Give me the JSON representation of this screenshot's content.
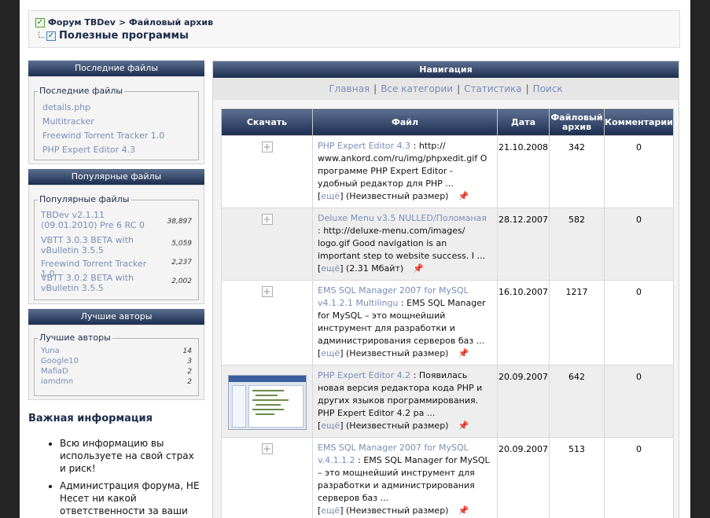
{
  "breadcrumb": {
    "forum": "Форум TBDev",
    "separator": ">",
    "section": "Файловый архив",
    "title": "Полезные программы"
  },
  "recent": {
    "header": "Последние файлы",
    "legend": "Последние файлы",
    "items": [
      "details.php",
      "Multitracker",
      "Freewind Torrent Tracker 1.0",
      "PHP Expert Editor 4.3"
    ]
  },
  "popular": {
    "header": "Популярные файлы",
    "legend": "Популярные файлы",
    "items": [
      {
        "name": "TBDev v2.1.11 (09.01.2010) Pre 6 RC 0",
        "count": "38,897"
      },
      {
        "name": "VBTT 3.0.3 BETA with vBulletin 3.5.5",
        "count": "5,059"
      },
      {
        "name": "Freewind Torrent Tracker 1.0",
        "count": "2,237"
      },
      {
        "name": "VBTT 3.0.2 BETA with vBulletin 3.5.5",
        "count": "2,002"
      }
    ]
  },
  "authors": {
    "header": "Лучшие авторы",
    "legend": "Лучшие авторы",
    "items": [
      {
        "name": "Yuna",
        "count": "14"
      },
      {
        "name": "Google10",
        "count": "3"
      },
      {
        "name": "MafiaD",
        "count": "2"
      },
      {
        "name": "iamdmn",
        "count": "2"
      }
    ]
  },
  "info": {
    "title": "Важная информация",
    "items": [
      "Всю информацию вы используете на свой страх и риск!",
      "Администрация форума, НЕ Несет ни какой ответственности за ваши файлы"
    ]
  },
  "nav": {
    "header": "Навигация",
    "links": [
      "Главная",
      "Все категории",
      "Статистика",
      "Поиск"
    ],
    "separator": "|"
  },
  "table": {
    "headers": [
      "Скачать",
      "Файл",
      "Дата",
      "Файловый архив",
      "Комментарии"
    ],
    "rows": [
      {
        "name": "PHP Expert Editor 4.3",
        "desc": ": http:// www.ankord.com/ru/img/phpxedit.gif О программе PHP Expert Editor - удобный редактор для PHP ...",
        "more": "ещё",
        "size": "(Неизвестный размер)",
        "date": "21.10.2008",
        "views": "342",
        "comments": "0",
        "thumb": false
      },
      {
        "name": "Deluxe Menu v3.5 NULLED/Поломаная",
        "desc": ": http://deluxe-menu.com/images/ logo.gif Good navigation is an important step to website success. I ...",
        "more": "ещё",
        "size": "(2.31 Мбайт)",
        "date": "28.12.2007",
        "views": "582",
        "comments": "0",
        "thumb": false
      },
      {
        "name": "EMS SQL Manager 2007 for MySQL v4.1.2.1 Multilingu",
        "desc": ": EMS SQL Manager for MySQL – это мощнейший инструмент для разработки и администрирования серверов баз ...",
        "more": "ещё",
        "size": "(Неизвестный размер)",
        "date": "16.10.2007",
        "views": "1217",
        "comments": "0",
        "thumb": false
      },
      {
        "name": "PHP Expert Editor 4.2",
        "desc": ": Появилась новая версия редактора кода PHP и других языков программирования. PHP Expert Editor 4.2 ра ...",
        "more": "ещё",
        "size": "(Неизвестный размер)",
        "date": "20.09.2007",
        "views": "642",
        "comments": "0",
        "thumb": true
      },
      {
        "name": "EMS SQL Manager 2007 for MySQL v.4.1.1.2",
        "desc": ": EMS SQL Manager for MySQL – это мощнейший инструмент для разработки и администрирования серверов баз ...",
        "more": "ещё",
        "size": "(Неизвестный размер)",
        "date": "20.09.2007",
        "views": "513",
        "comments": "0",
        "thumb": false
      }
    ]
  },
  "icons": {
    "expand": "plus-icon",
    "pin": "pin-icon",
    "check": "checkbox-icon"
  },
  "colors": {
    "header_dark": "#1c2d4f",
    "header_light": "#5d7091",
    "link": "#7a8db8",
    "background": "#252525"
  }
}
